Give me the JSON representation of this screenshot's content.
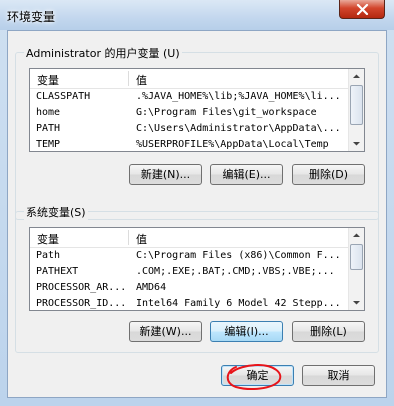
{
  "window": {
    "title": "环境变量"
  },
  "user_vars": {
    "group_title": "Administrator 的用户变量 (U)",
    "columns": {
      "name": "变量",
      "value": "值"
    },
    "rows": [
      {
        "name": "CLASSPATH",
        "value": ".%JAVA_HOME%\\lib;%JAVA_HOME%\\li..."
      },
      {
        "name": "home",
        "value": "G:\\Program Files\\git_workspace"
      },
      {
        "name": "PATH",
        "value": "C:\\Users\\Administrator\\AppData\\..."
      },
      {
        "name": "TEMP",
        "value": "%USERPROFILE%\\AppData\\Local\\Temp"
      }
    ],
    "buttons": {
      "new": "新建(N)...",
      "edit": "编辑(E)...",
      "delete": "删除(D)"
    }
  },
  "system_vars": {
    "group_title": "系统变量(S)",
    "columns": {
      "name": "变量",
      "value": "值"
    },
    "rows": [
      {
        "name": "Path",
        "value": "C:\\Program Files (x86)\\Common F..."
      },
      {
        "name": "PATHEXT",
        "value": ".COM;.EXE;.BAT;.CMD;.VBS;.VBE;..."
      },
      {
        "name": "PROCESSOR_AR...",
        "value": "AMD64"
      },
      {
        "name": "PROCESSOR_ID...",
        "value": "Intel64 Family 6 Model 42 Stepp..."
      }
    ],
    "buttons": {
      "new": "新建(W)...",
      "edit": "编辑(I)...",
      "delete": "删除(L)"
    }
  },
  "footer": {
    "ok": "确定",
    "cancel": "取消"
  },
  "colors": {
    "annotation_circle": "#e8141a",
    "focus_border": "#3c7fb1"
  }
}
